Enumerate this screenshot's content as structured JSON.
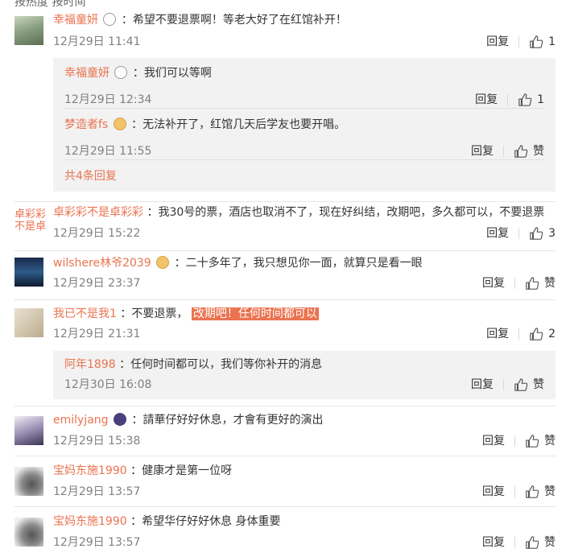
{
  "top_cut": "按热度  按时间",
  "labels": {
    "reply": "回复",
    "praise": "赞"
  },
  "comments": [
    {
      "name": "幸福童妍",
      "text": "：希望不要退票啊！等老大好了在红馆补开！",
      "time": "12月29日 11:41",
      "likes": "1",
      "replies": [
        {
          "name": "幸福童妍",
          "text": "：我们可以等啊",
          "time": "12月29日 12:34",
          "likes": "1"
        },
        {
          "name": "梦造者fs",
          "text": "：无法补开了，红馆几天后学友也要开唱。",
          "time": "12月29日 11:55",
          "likes": "赞"
        }
      ],
      "more": "共4条回复"
    },
    {
      "name": "卓彩彩不是卓彩彩",
      "avatar_alt": "卓彩彩不是卓",
      "text": "：我30号的票，酒店也取消不了，现在好纠结，改期吧，多久都可以，不要退票",
      "time": "12月29日 15:22",
      "likes": "3"
    },
    {
      "name": "wilshere林爷2039",
      "text": "：二十多年了，我只想见你一面，就算只是看一眼",
      "time": "12月29日 23:37",
      "likes": "赞"
    },
    {
      "name": "我已不是我1",
      "text": "：不要退票，",
      "highlight": "改期吧！任何时间都可以",
      "time": "12月29日 21:31",
      "likes": "2",
      "replies": [
        {
          "name": "阿年1898",
          "text": "：任何时间都可以，我们等你补开的消息",
          "time": "12月30日 16:08",
          "likes": "赞"
        }
      ]
    },
    {
      "name": "emilyjang",
      "text": "：請華仔好好休息，才會有更好的演出",
      "time": "12月29日 15:38",
      "likes": "赞"
    },
    {
      "name": "宝妈东施1990",
      "text": "：健康才是第一位呀",
      "time": "12月29日 13:57",
      "likes": "赞"
    },
    {
      "name": "宝妈东施1990",
      "text": "：希望华仔好好休息 身体重要",
      "time": "12月29日 13:57",
      "likes": "赞"
    }
  ],
  "colors": {
    "name": "#eb7350",
    "meta": "#808080",
    "sub_bg": "#f2f2f2"
  }
}
